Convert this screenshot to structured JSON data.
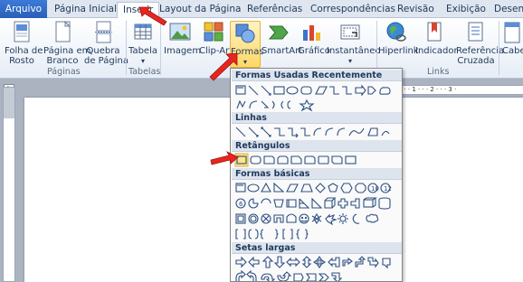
{
  "tabs": [
    {
      "label": "Arquivo"
    },
    {
      "label": "Página Inicial"
    },
    {
      "label": "Inserir"
    },
    {
      "label": "Layout da Página"
    },
    {
      "label": "Referências"
    },
    {
      "label": "Correspondências"
    },
    {
      "label": "Revisão"
    },
    {
      "label": "Exibição"
    },
    {
      "label": "Desenv"
    }
  ],
  "ribbon": {
    "groups": {
      "paginas": "Páginas",
      "tabelas": "Tabelas",
      "links": "Links"
    },
    "buttons": {
      "folha_rosto": [
        "Folha de",
        "Rosto"
      ],
      "pagina_branco": [
        "Página em",
        "Branco"
      ],
      "quebra_pagina": [
        "Quebra",
        "de Página"
      ],
      "tabela": "Tabela",
      "imagem": "Imagem",
      "clipart": "Clip-Art",
      "formas": "Formas",
      "smartart": "SmartArt",
      "grafico": "Gráfico",
      "instantaneo": "Instantâneo",
      "hiperlink": "Hiperlink",
      "indicador": "Indicador",
      "referencia_cruzada": [
        "Referência",
        "Cruzada"
      ],
      "cabecalho": "Cabe"
    }
  },
  "ruler": {
    "corner": "L",
    "ticks": "·  ·  ·  1  ·  ·  ·  2  ·  ·  ·  3  ·"
  },
  "shapes_menu": {
    "sections": [
      {
        "title": "Formas Usadas Recentemente"
      },
      {
        "title": "Linhas"
      },
      {
        "title": "Retângulos"
      },
      {
        "title": "Formas básicas"
      },
      {
        "title": "Setas largas"
      }
    ]
  },
  "colors": {
    "file_tab": "#2a5fb7",
    "accent_arrow": "#e8251f",
    "highlight": "#ffd766"
  }
}
